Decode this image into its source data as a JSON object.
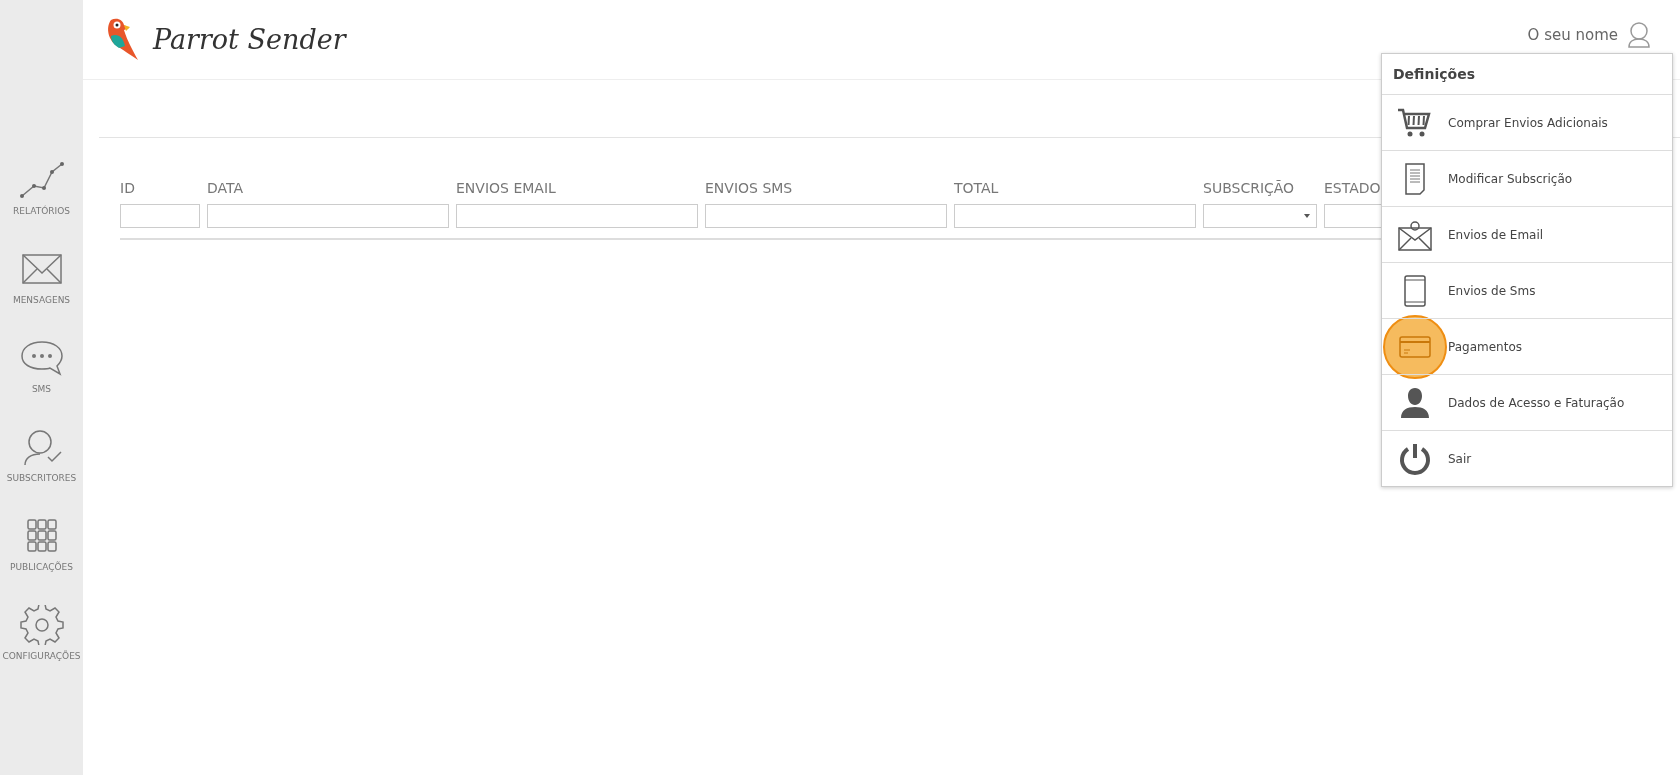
{
  "sidebar": {
    "items": [
      {
        "label": "RELATÓRIOS",
        "kind": "chart"
      },
      {
        "label": "MENSAGENS",
        "kind": "envelope"
      },
      {
        "label": "SMS",
        "kind": "chat"
      },
      {
        "label": "SUBSCRITORES",
        "kind": "user-check"
      },
      {
        "label": "PUBLICAÇÕES",
        "kind": "grid"
      },
      {
        "label": "CONFIGURAÇÕES",
        "kind": "gear"
      }
    ]
  },
  "header": {
    "logo": "Parrot Sender",
    "user_name": "O seu nome"
  },
  "table": {
    "columns": [
      {
        "label": "ID",
        "kind": "text"
      },
      {
        "label": "DATA",
        "kind": "text"
      },
      {
        "label": "ENVIOS EMAIL",
        "kind": "text"
      },
      {
        "label": "ENVIOS SMS",
        "kind": "text"
      },
      {
        "label": "TOTAL",
        "kind": "text"
      },
      {
        "label": "SUBSCRIÇÃO",
        "kind": "select"
      },
      {
        "label": "ESTADO",
        "kind": "text"
      }
    ]
  },
  "settings_menu": {
    "title": "Definições",
    "items": [
      {
        "label": "Comprar Envios Adicionais",
        "kind": "cart",
        "highlighted": false
      },
      {
        "label": "Modificar Subscrição",
        "kind": "document",
        "highlighted": false
      },
      {
        "label": "Envios de Email",
        "kind": "email",
        "highlighted": false
      },
      {
        "label": "Envios de Sms",
        "kind": "phone",
        "highlighted": false
      },
      {
        "label": "Pagamentos",
        "kind": "card",
        "highlighted": true
      },
      {
        "label": "Dados de Acesso e Faturação",
        "kind": "person",
        "highlighted": false
      },
      {
        "label": "Sair",
        "kind": "power",
        "highlighted": false
      }
    ]
  }
}
